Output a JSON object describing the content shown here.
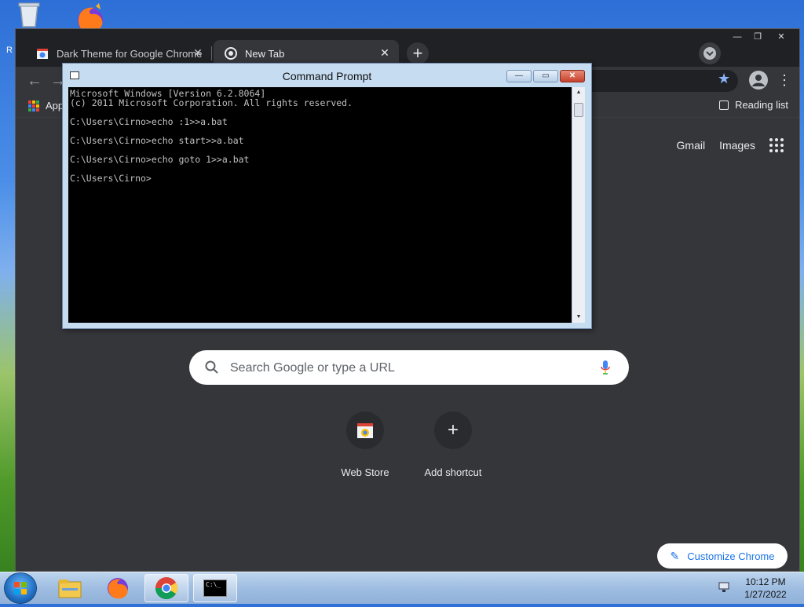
{
  "desktop": {
    "partial_letter": "R"
  },
  "chrome": {
    "tabs": [
      {
        "title": "Dark Theme for Google Chrome",
        "close": "✕"
      },
      {
        "title": "New Tab",
        "close": "✕"
      }
    ],
    "new_tab_symbol": "+",
    "window_controls": {
      "minimize": "—",
      "restore": "❐",
      "close": "✕"
    },
    "toolbar": {
      "back": "←",
      "forward": "→",
      "star": "★",
      "menu": "⋮"
    },
    "bookmarks": {
      "apps_label": "Apps",
      "reading_list": "Reading list"
    },
    "top_links": {
      "gmail": "Gmail",
      "images": "Images"
    },
    "search": {
      "placeholder": "Search Google or type a URL"
    },
    "shortcuts": [
      {
        "label": "Web Store",
        "icon": "web-store-icon"
      },
      {
        "label": "Add shortcut",
        "icon": "plus-icon",
        "symbol": "+"
      }
    ],
    "customize": {
      "label": "Customize Chrome",
      "icon": "pencil-icon",
      "symbol": "✎"
    },
    "colors": {
      "frame": "#202124",
      "toolbar": "#35363a",
      "accent": "#8ab4f8"
    }
  },
  "cmd": {
    "title": "Command Prompt",
    "buttons": {
      "minimize": "—",
      "maximize": "▭",
      "close": "✕"
    },
    "output": "Microsoft Windows [Version 6.2.8064]\n(c) 2011 Microsoft Corporation. All rights reserved.\n\nC:\\Users\\Cirno>echo :1>>a.bat\n\nC:\\Users\\Cirno>echo start>>a.bat\n\nC:\\Users\\Cirno>echo goto 1>>a.bat\n\nC:\\Users\\Cirno>",
    "scroll_up": "▲",
    "scroll_down": "▼"
  },
  "taskbar": {
    "items": [
      {
        "name": "explorer-icon"
      },
      {
        "name": "firefox-icon"
      },
      {
        "name": "chrome-icon"
      },
      {
        "name": "cmd-icon",
        "active": true,
        "glyph": "C:\\_"
      }
    ],
    "clock": {
      "time": "10:12 PM",
      "date": "1/27/2022"
    }
  }
}
